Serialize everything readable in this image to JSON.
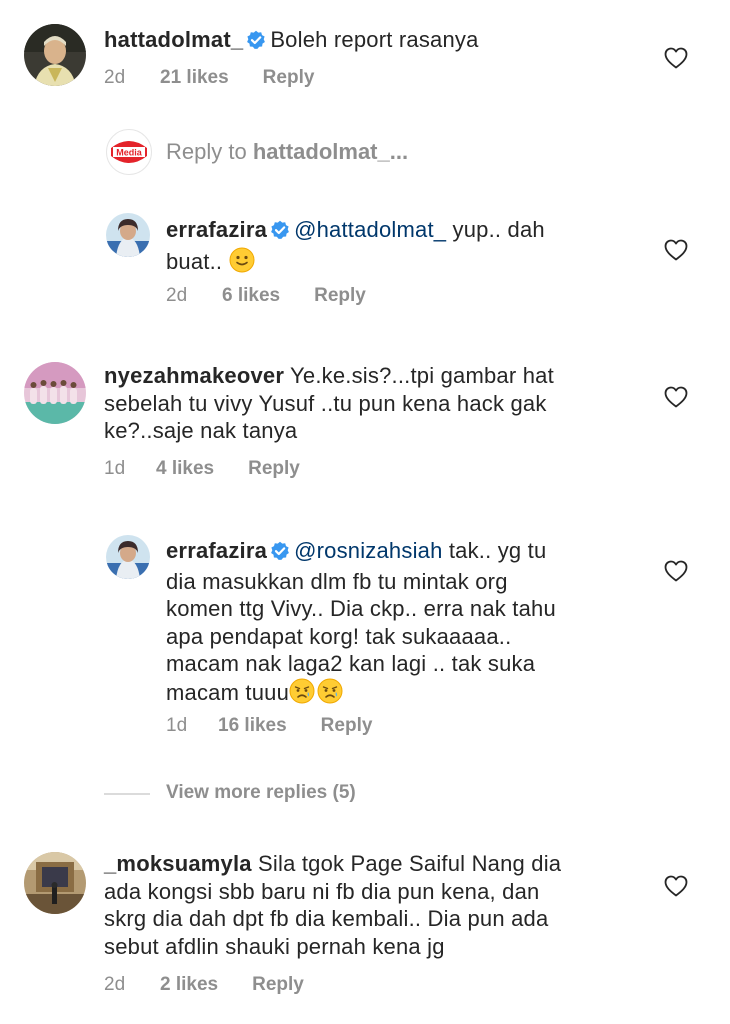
{
  "comments": [
    {
      "username": "hattadolmat_",
      "lines": [
        "Boleh report rasanya"
      ],
      "time": "2d",
      "likes": "21 likes",
      "reply": "Reply"
    },
    {
      "username": "errafazira",
      "mention": "@hattadolmat_",
      "lines": [
        "yup.. dah",
        "buat.."
      ],
      "time": "2d",
      "likes": "6 likes",
      "reply": "Reply"
    },
    {
      "username": "nyezahmakeover",
      "lines": [
        "Ye.ke.sis?...tpi gambar hat",
        "sebelah tu vivy Yusuf ..tu pun kena hack gak",
        "ke?..saje nak tanya"
      ],
      "time": "1d",
      "likes": "4 likes",
      "reply": "Reply"
    },
    {
      "username": "errafazira",
      "mention": "@rosnizahsiah",
      "lines": [
        "tak.. yg tu",
        "dia masukkan dlm fb tu mintak org",
        "komen ttg Vivy.. Dia ckp.. erra nak tahu",
        "apa pendapat korg!  tak sukaaaaa..",
        "macam nak laga2 kan lagi .. tak suka",
        "macam tuuu"
      ],
      "time": "1d",
      "likes": "16 likes",
      "reply": "Reply"
    },
    {
      "username": "_moksuamyla",
      "lines": [
        "Sila tgok Page Saiful Nang dia",
        "ada kongsi sbb baru ni fb dia pun kena, dan",
        "skrg dia dah dpt fb dia kembali.. Dia pun ada",
        "sebut afdlin shauki pernah kena jg"
      ],
      "time": "2d",
      "likes": "2 likes",
      "reply": "Reply"
    }
  ],
  "reply_input": {
    "prefix": "Reply to ",
    "target": "hattadolmat_...",
    "avatar_text": "Media"
  },
  "view_more": "View more replies (5)",
  "icons": {
    "verified": "verified-badge-icon",
    "heart": "heart-outline-icon",
    "slightly_smiling": "slightly-smiling-face-icon",
    "sad_relieved": "sad-but-relieved-face-icon"
  },
  "colors": {
    "verified_blue": "#3897f0",
    "mention": "#00376b",
    "meta_gray": "#8e8e8e",
    "media_red": "#e4232a"
  }
}
